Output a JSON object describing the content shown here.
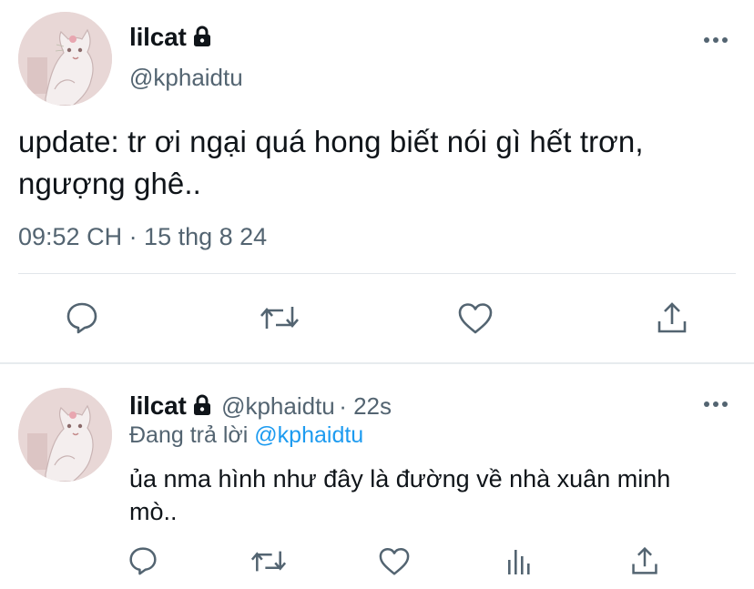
{
  "tweet": {
    "name": "lilcat",
    "handle": "@kphaidtu",
    "text_line1": "update: tr ơi ngại quá hong biết nói gì hết trơn,",
    "text_line2": "ngượng ghê..",
    "timestamp": "09:52 CH · 15 thg 8 24",
    "actions": [
      "reply-icon",
      "retweet-icon",
      "like-icon",
      "share-icon"
    ]
  },
  "reply": {
    "name": "lilcat",
    "handle": "@kphaidtu",
    "sep_time": "· 22s",
    "replying_prefix": "Đang trả lời",
    "replying_to": "@kphaidtu",
    "text_line1": "ủa nma hình như đây là đường về nhà xuân minh",
    "text_line2": "mò..",
    "actions": [
      "reply-icon",
      "retweet-icon",
      "like-icon",
      "analytics-icon",
      "share-icon"
    ]
  },
  "colors": {
    "text": "#0f1419",
    "secondary": "#536471",
    "accent": "#1d9bf0",
    "divider": "#e1e6ea"
  }
}
